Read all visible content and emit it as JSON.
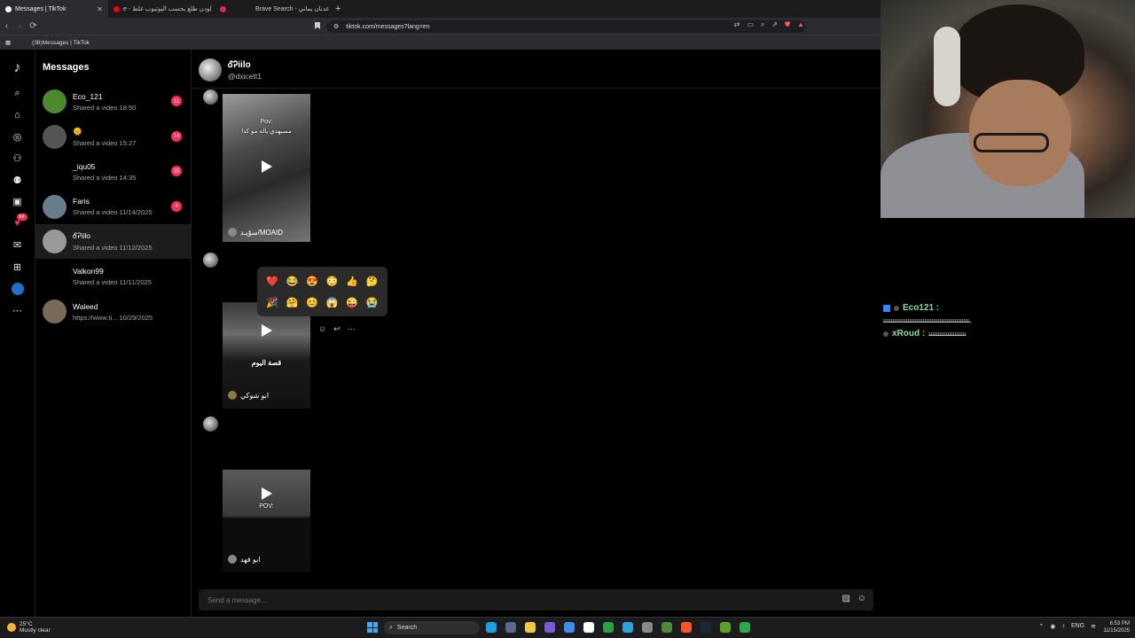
{
  "browser": {
    "tabs": [
      {
        "title": "Messages | TikTok",
        "active": true
      },
      {
        "title": "e - لودن طلع يحسب اليوتيوب غلط"
      },
      {
        "title": ""
      },
      {
        "title": "Brave Search - عدنان يماني"
      }
    ],
    "url": "tiktok.com/messages?lang=en",
    "bookmark": "(38)Messages | TikTok"
  },
  "sidebar": {
    "title": "Messages",
    "rail_badge": "64"
  },
  "conversations": [
    {
      "name": "Eco_121",
      "sub": "Shared a video 18:50",
      "badge": "11",
      "avatar": "#4a8a2c"
    },
    {
      "name": "🌞",
      "sub": "Shared a video 15:27",
      "badge": "14",
      "avatar": "#555"
    },
    {
      "name": "_iqu05",
      "sub": "Shared a video 14:35",
      "badge": "35",
      "avatar": "#000"
    },
    {
      "name": "Faris",
      "sub": "Shared a video 11/14/2025",
      "badge": "4",
      "avatar": "#6a7d8c"
    },
    {
      "name": "ᎴᎮiilo",
      "sub": "Shared a video 11/12/2025",
      "badge": "",
      "avatar": "#999",
      "selected": true
    },
    {
      "name": "Valkon99",
      "sub": "Shared a video 11/11/2025",
      "badge": "",
      "avatar": "#000"
    },
    {
      "name": "Waleed",
      "sub": "https://www.ti... 10/29/2025",
      "badge": "",
      "avatar": "#7a6a5a"
    }
  ],
  "chat": {
    "name": "ᎴᎮiilo",
    "handle": "@dxicett1",
    "videos": [
      {
        "text1": "Pov:",
        "text2": "مسيهدي ياله مو كذا",
        "author": "سوّيـد/MOAID"
      },
      {
        "text1": "قصة اليوم",
        "text2": "",
        "author": "ابو شوكي"
      },
      {
        "text1": "POV:",
        "text2": "",
        "author": "ابو فهد"
      }
    ],
    "emojis": [
      "❤️",
      "😂",
      "😍",
      "😳",
      "👍",
      "🤔",
      "🎉",
      "🤗",
      "😊",
      "😱",
      "😜",
      "😭"
    ],
    "composer_placeholder": "Send a message..."
  },
  "stream_chat": [
    {
      "user": "Eco121 :",
      "text": ""
    },
    {
      "user": "",
      "text": "ـﺌﺌﺌﺌﺌﺌﺌﺌﺌﺌﺌﺌﺌﺌﺌﺌﺌﺌﺌﺌﺌﺌﺌﺌﺌﺌﺌﺌﺌﺌﺌﺌﺌﺌﺌﺌﺌﺌﺌﺌﺌﺌﺌﺌﺌﺌ"
    },
    {
      "user": "xRoud :",
      "text": "ﺌﺌﺌﺌﺌﺌﺌﺌﺌﺌﺌﺌﺌﺌﺌﺌﺌﺌﺌﺌ"
    }
  ],
  "taskbar": {
    "weather_temp": "25°C",
    "weather_desc": "Mostly clear",
    "search": "Search",
    "lang": "ENG",
    "time": "6:53 PM",
    "date": "11/15/2025"
  }
}
